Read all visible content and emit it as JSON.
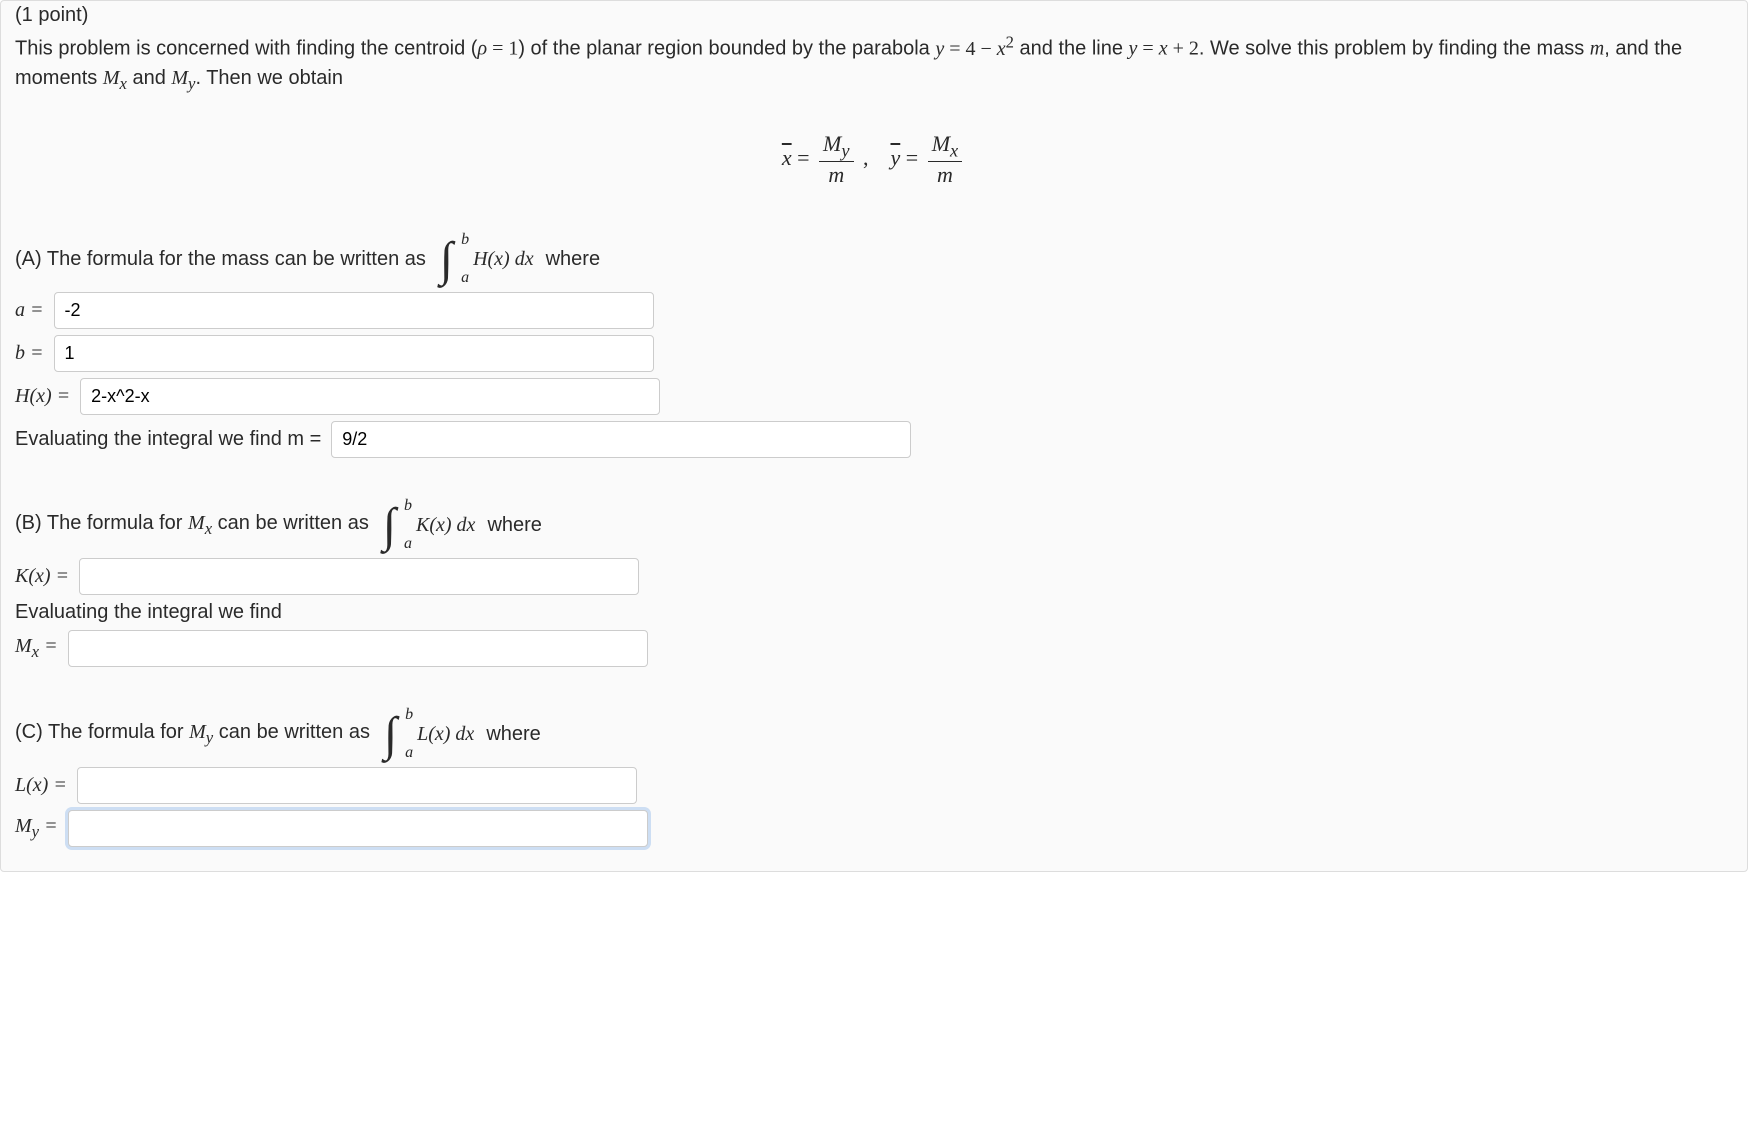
{
  "header": {
    "points": "(1 point)",
    "intro_html": "This problem is concerned with finding the centroid (<span class='serif'><i>ρ</i> = 1</span>) of the planar region bounded by the parabola <span class='serif'><i>y</i> = 4 − <i>x</i><sup>2</sup></span> and the line <span class='serif'><i>y</i> = <i>x</i> + 2</span>. We solve this problem by finding the mass <span class='serif'><i>m</i></span>, and the moments <span class='serif'><i>M<sub>x</sub></i></span> and <span class='serif'><i>M<sub>y</sub></i></span>. Then we obtain"
  },
  "center_eq_html": "<span class='serif'><span class='bar'><i>x</i></span> = <span class='frac'><span class='num'><i>M<sub>y</sub></i></span><span class='den'><i>m</i></span></span> , &nbsp;&nbsp; <span class='bar'><i>y</i></span> = <span class='frac'><span class='num'><i>M<sub>x</sub></i></span><span class='den'><i>m</i></span></span></span>",
  "partA": {
    "lead": "(A) The formula for the mass can be written as",
    "int_fn": "H(x) dx",
    "where": "where",
    "a_label": "a =",
    "a_value": "-2",
    "b_label": "b =",
    "b_value": "1",
    "hx_label": "H(x) =",
    "hx_value": "2-x^2-x",
    "eval_label": "Evaluating the integral we find m =",
    "m_value": "9/2"
  },
  "partB": {
    "lead_html": "(B) The formula for <span class='serif'><i>M<sub>x</sub></i></span> can be written as",
    "int_fn": "K(x) dx",
    "where": "where",
    "kx_label": "K(x) =",
    "kx_value": "",
    "eval_label": "Evaluating the integral we find",
    "mx_label_html": "<i>M<sub>x</sub></i> =",
    "mx_value": ""
  },
  "partC": {
    "lead_html": "(C) The formula for <span class='serif'><i>M<sub>y</sub></i></span> can be written as",
    "int_fn": "L(x) dx",
    "where": "where",
    "lx_label": "L(x) =",
    "lx_value": "",
    "my_label_html": "<i>M<sub>y</sub></i> =",
    "my_value": ""
  }
}
